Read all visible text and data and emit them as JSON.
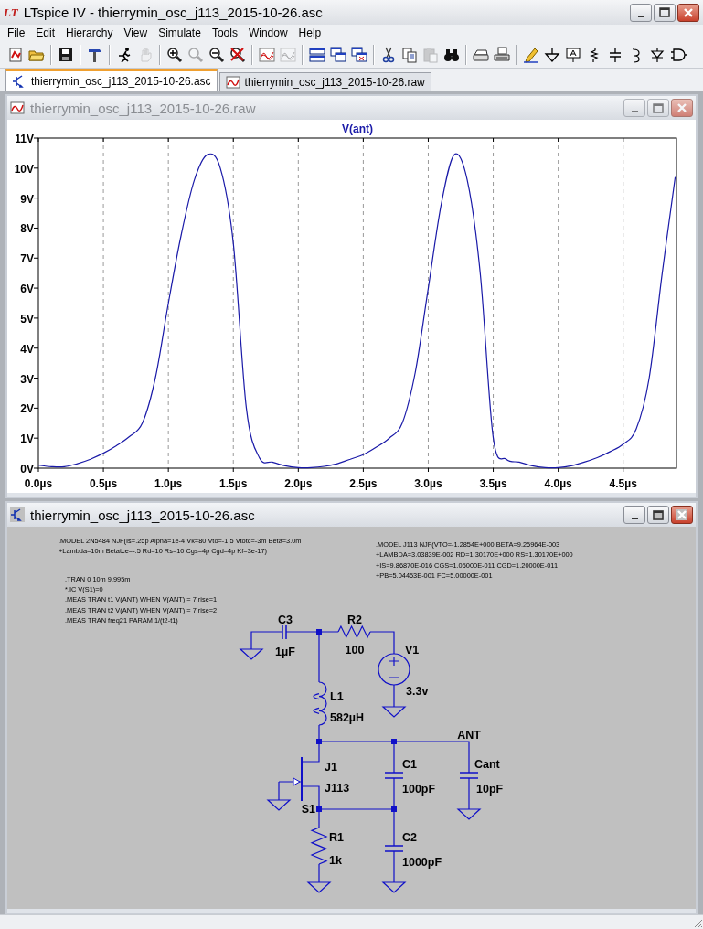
{
  "window": {
    "logo": "LT",
    "title": "LTspice IV - thierrymin_osc_j113_2015-10-26.asc"
  },
  "menu": [
    "File",
    "Edit",
    "Hierarchy",
    "View",
    "Simulate",
    "Tools",
    "Window",
    "Help"
  ],
  "toolbar": [
    {
      "kind": "new",
      "disabled": false
    },
    {
      "kind": "open",
      "disabled": false
    },
    {
      "kind": "sep"
    },
    {
      "kind": "save",
      "disabled": false
    },
    {
      "kind": "sep"
    },
    {
      "kind": "hammer",
      "disabled": false
    },
    {
      "kind": "sep"
    },
    {
      "kind": "run",
      "disabled": false
    },
    {
      "kind": "hand",
      "disabled": true
    },
    {
      "kind": "sep"
    },
    {
      "kind": "zoom-in",
      "disabled": false
    },
    {
      "kind": "zoom-fit",
      "disabled": true
    },
    {
      "kind": "zoom-out",
      "disabled": false
    },
    {
      "kind": "zoom-cancel",
      "disabled": false
    },
    {
      "kind": "sep"
    },
    {
      "kind": "plot",
      "disabled": false
    },
    {
      "kind": "plot",
      "disabled": true
    },
    {
      "kind": "sep"
    },
    {
      "kind": "tile",
      "disabled": false
    },
    {
      "kind": "cascade",
      "disabled": false
    },
    {
      "kind": "close-windows",
      "disabled": false
    },
    {
      "kind": "sep"
    },
    {
      "kind": "cut",
      "disabled": false
    },
    {
      "kind": "copy",
      "disabled": false
    },
    {
      "kind": "paste",
      "disabled": true
    },
    {
      "kind": "find",
      "disabled": false
    },
    {
      "kind": "sep"
    },
    {
      "kind": "print-preview",
      "disabled": false
    },
    {
      "kind": "print",
      "disabled": false
    },
    {
      "kind": "sep"
    },
    {
      "kind": "pencil",
      "disabled": false
    },
    {
      "kind": "ground",
      "disabled": false
    },
    {
      "kind": "label",
      "disabled": false
    },
    {
      "kind": "resistor",
      "disabled": false
    },
    {
      "kind": "capacitor",
      "disabled": false
    },
    {
      "kind": "inductor",
      "disabled": false
    },
    {
      "kind": "diode",
      "disabled": false
    },
    {
      "kind": "component",
      "disabled": false
    }
  ],
  "tabs": [
    {
      "kind": "schematic",
      "label": "thierrymin_osc_j113_2015-10-26.asc",
      "selected": true
    },
    {
      "kind": "waveform",
      "label": "thierrymin_osc_j113_2015-10-26.raw",
      "selected": false
    }
  ],
  "plot_window": {
    "title": "thierrymin_osc_j113_2015-10-26.raw",
    "active": false,
    "chart_data": {
      "type": "line",
      "grid": true,
      "x": [
        0,
        0.1,
        0.2,
        0.3,
        0.4,
        0.5,
        0.6,
        0.7,
        0.8,
        0.9,
        1.0,
        1.1,
        1.2,
        1.3,
        1.4,
        1.5,
        1.6,
        1.7,
        1.8,
        1.9,
        2.0,
        2.1,
        2.2,
        2.3,
        2.4,
        2.5,
        2.6,
        2.7,
        2.8,
        2.9,
        3.0,
        3.1,
        3.2,
        3.3,
        3.4,
        3.5,
        3.6,
        3.7,
        3.8,
        3.9,
        4.0,
        4.1,
        4.2,
        4.3,
        4.4,
        4.5,
        4.6,
        4.7,
        4.8,
        4.9
      ],
      "series": [
        {
          "name": "V(ant)",
          "color": "#1a1aa8",
          "values": [
            0.1,
            0.05,
            0.05,
            0.15,
            0.3,
            0.5,
            0.75,
            1.05,
            1.5,
            3.0,
            5.5,
            7.8,
            9.6,
            10.45,
            10.0,
            7.5,
            2.0,
            0.35,
            0.2,
            0.08,
            0.02,
            0.02,
            0.06,
            0.15,
            0.3,
            0.45,
            0.7,
            1.0,
            1.5,
            3.2,
            6.0,
            8.8,
            10.45,
            9.6,
            6.5,
            1.0,
            0.3,
            0.2,
            0.08,
            0.02,
            0.02,
            0.08,
            0.2,
            0.35,
            0.55,
            0.8,
            1.3,
            3.0,
            6.5,
            9.7
          ]
        }
      ],
      "xlim": [
        0,
        4.91
      ],
      "ylim": [
        0,
        11
      ],
      "xticks": [
        {
          "value": 0,
          "label": "0.0µs"
        },
        {
          "value": 0.5,
          "label": "0.5µs"
        },
        {
          "value": 1.0,
          "label": "1.0µs"
        },
        {
          "value": 1.5,
          "label": "1.5µs"
        },
        {
          "value": 2.0,
          "label": "2.0µs"
        },
        {
          "value": 2.5,
          "label": "2.5µs"
        },
        {
          "value": 3.0,
          "label": "3.0µs"
        },
        {
          "value": 3.5,
          "label": "3.5µs"
        },
        {
          "value": 4.0,
          "label": "4.0µs"
        },
        {
          "value": 4.5,
          "label": "4.5µs"
        }
      ],
      "yticks": [
        {
          "value": 0,
          "label": "0V"
        },
        {
          "value": 1,
          "label": "1V"
        },
        {
          "value": 2,
          "label": "2V"
        },
        {
          "value": 3,
          "label": "3V"
        },
        {
          "value": 4,
          "label": "4V"
        },
        {
          "value": 5,
          "label": "5V"
        },
        {
          "value": 6,
          "label": "6V"
        },
        {
          "value": 7,
          "label": "7V"
        },
        {
          "value": 8,
          "label": "8V"
        },
        {
          "value": 9,
          "label": "9V"
        },
        {
          "value": 10,
          "label": "10V"
        },
        {
          "value": 11,
          "label": "11V"
        }
      ]
    }
  },
  "schematic_window": {
    "title": "thierrymin_osc_j113_2015-10-26.asc",
    "active": true,
    "directives": [
      {
        "lines": [
          ".MODEL 2N5484 NJF(Is=.25p Alpha=1e-4 Vk=80 Vto=-1.5 Vtotc=-3m Beta=3.0m",
          "+Lambda=10m Betatce=-.5 Rd=10 Rs=10 Cgs=4p Cgd=4p Kf=3e-17)"
        ]
      },
      {
        "lines": [
          ".TRAN 0 10m 9.995m",
          "*.IC V(S1)=0",
          ".MEAS TRAN t1 V(ANT) WHEN V(ANT) = 7 rise=1",
          ".MEAS TRAN t2 V(ANT) WHEN V(ANT) = 7 rise=2",
          ".MEAS TRAN freq21 PARAM 1/(t2-t1)"
        ]
      },
      {
        "lines": [
          ".MODEL J113 NJF(VTO=-1.2854E+000 BETA=9.25964E-003",
          "+LAMBDA=3.03839E-002 RD=1.30170E+000 RS=1.30170E+000",
          "+IS=9.86870E-016 CGS=1.05000E-011 CGD=1.20000E-011",
          "+PB=5.04453E-001 FC=5.00000E-001"
        ]
      }
    ],
    "components": [
      {
        "kind": "capacitor",
        "ref": "C3",
        "value": "1µF"
      },
      {
        "kind": "resistor",
        "ref": "R2",
        "value": "100"
      },
      {
        "kind": "voltage-source",
        "ref": "V1",
        "value": "3.3v"
      },
      {
        "kind": "inductor",
        "ref": "L1",
        "value": "582µH"
      },
      {
        "kind": "jfet",
        "ref": "J1",
        "value": "J113"
      },
      {
        "kind": "capacitor",
        "ref": "C1",
        "value": "100pF"
      },
      {
        "kind": "capacitor",
        "ref": "Cant",
        "value": "10pF"
      },
      {
        "kind": "resistor",
        "ref": "R1",
        "value": "1k"
      },
      {
        "kind": "capacitor",
        "ref": "C2",
        "value": "1000pF"
      }
    ],
    "net_labels": [
      "ANT",
      "S1"
    ]
  }
}
